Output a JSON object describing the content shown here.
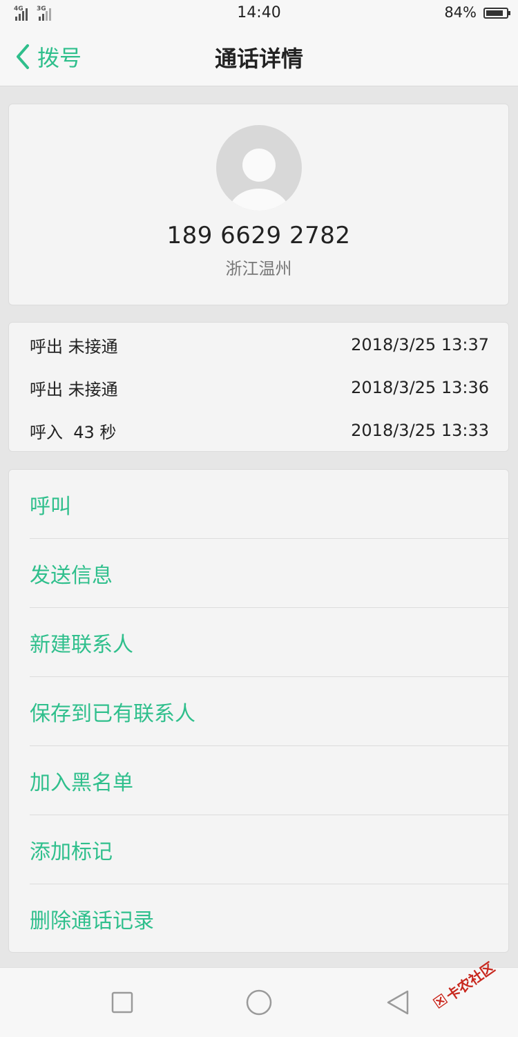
{
  "status_bar": {
    "signal1_label": "4G",
    "signal2_label": "3G",
    "time": "14:40",
    "battery_percent": "84%",
    "battery_level": 0.84
  },
  "header": {
    "back_label": "拨号",
    "title": "通话详情"
  },
  "contact": {
    "phone": "189 6629 2782",
    "location": "浙江温州"
  },
  "call_history": [
    {
      "type": "呼出 未接通",
      "datetime": "2018/3/25 13:37"
    },
    {
      "type": "呼出 未接通",
      "datetime": "2018/3/25 13:36"
    },
    {
      "type": "呼入  43 秒",
      "datetime": "2018/3/25 13:33"
    }
  ],
  "actions": [
    {
      "label": "呼叫"
    },
    {
      "label": "发送信息"
    },
    {
      "label": "新建联系人"
    },
    {
      "label": "保存到已有联系人"
    },
    {
      "label": "加入黑名单"
    },
    {
      "label": "添加标记"
    },
    {
      "label": "删除通话记录"
    }
  ],
  "navbar": {
    "icons": [
      "square-icon",
      "circle-icon",
      "back-triangle-icon"
    ]
  },
  "watermark": {
    "text": "卡农社区"
  },
  "colors": {
    "accent": "#2fbf8c",
    "background": "#e6e6e6",
    "card": "#f4f4f4"
  }
}
